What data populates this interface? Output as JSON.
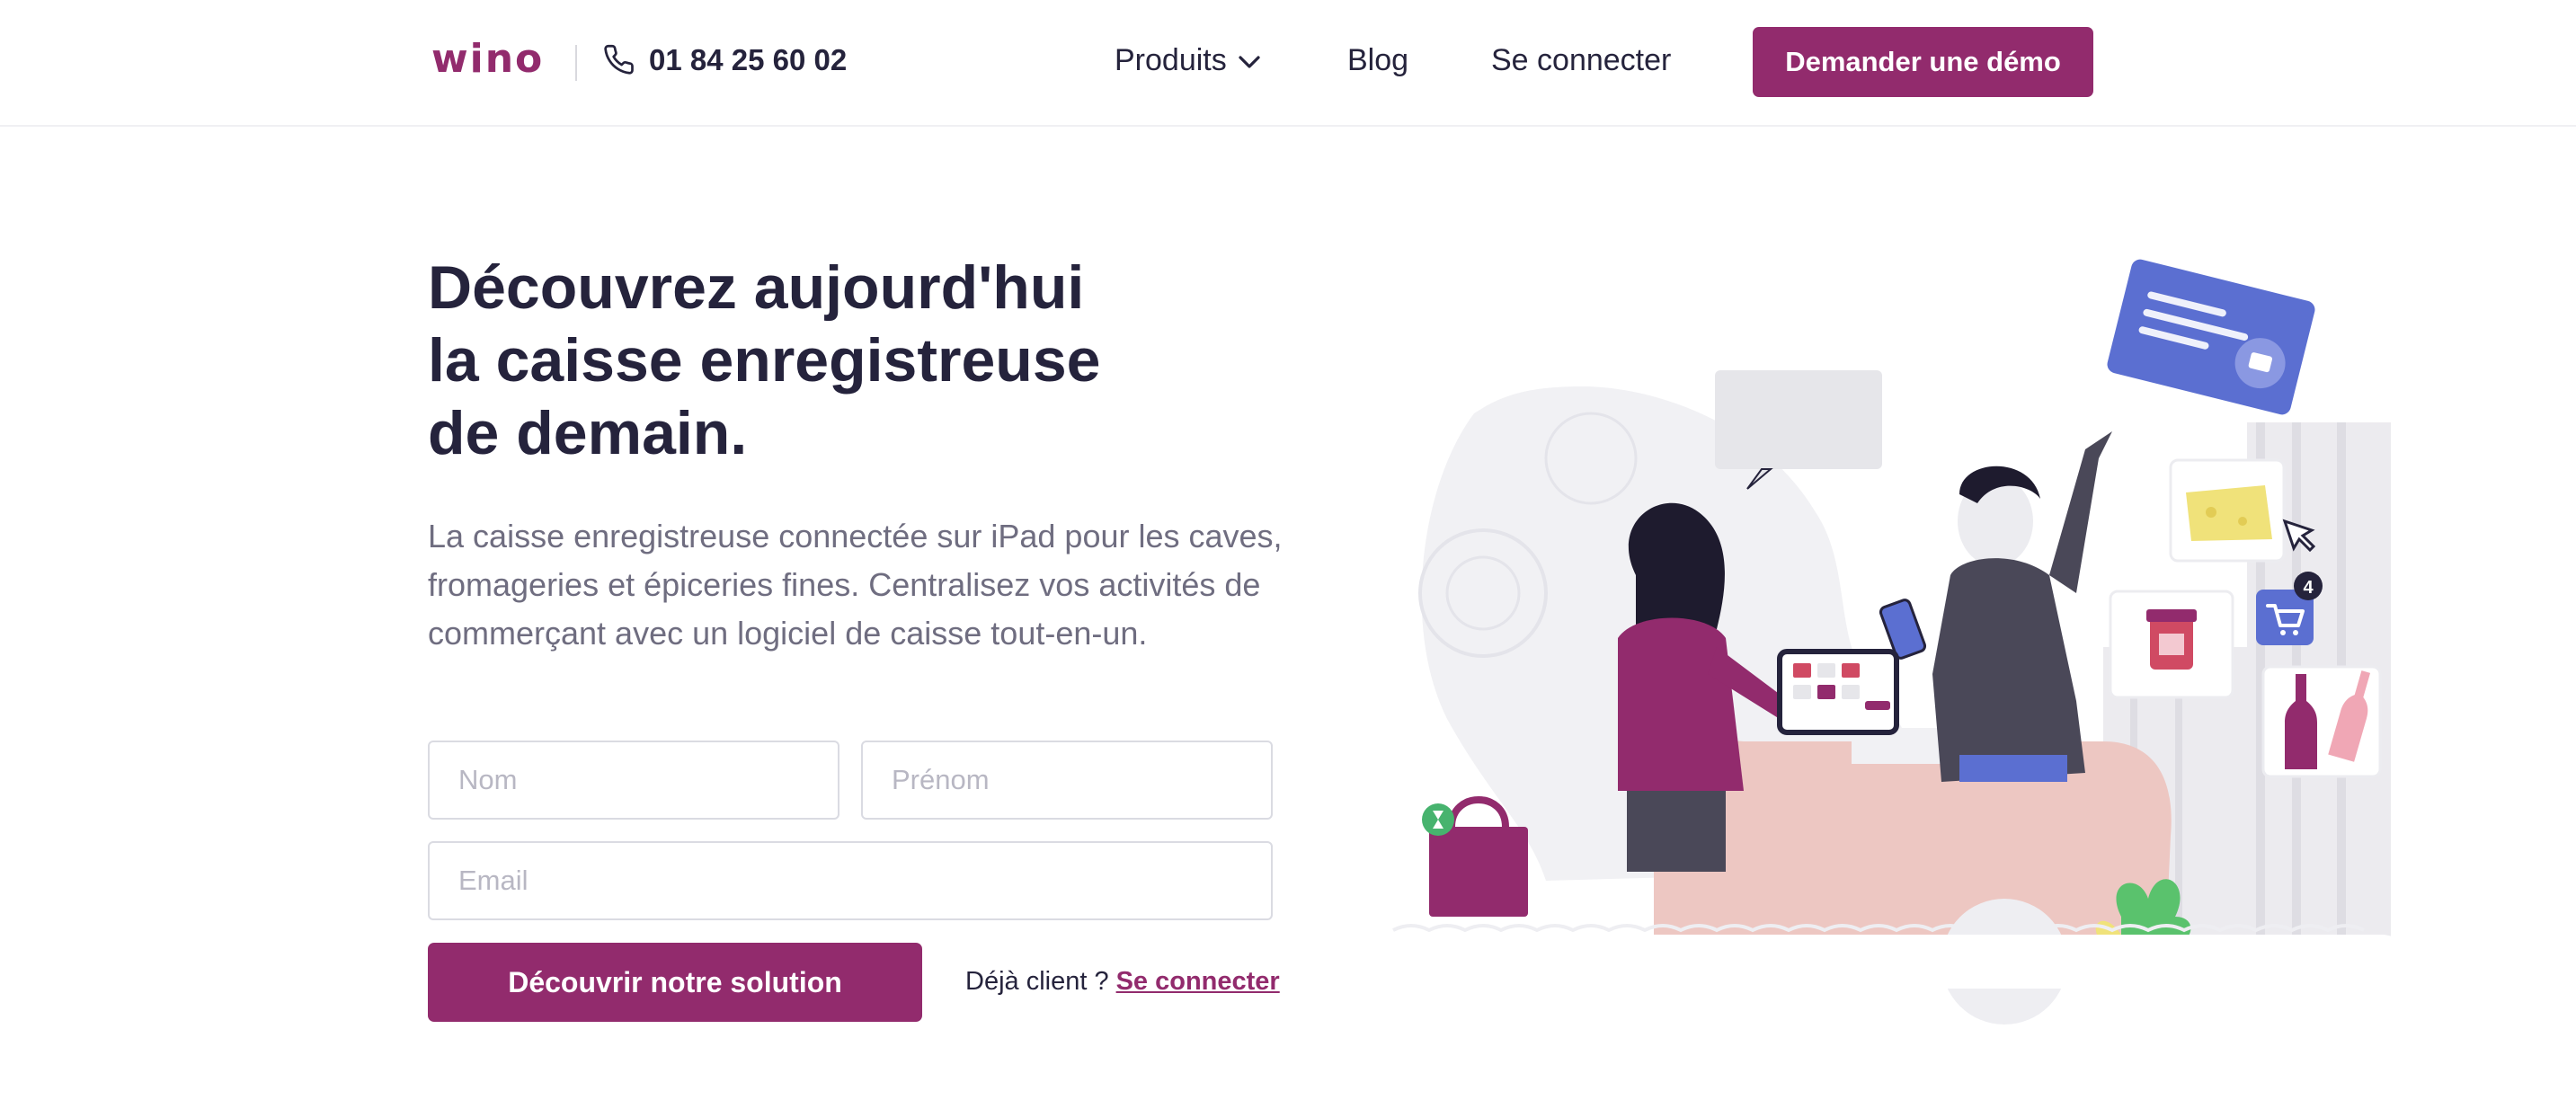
{
  "header": {
    "logo": "wino",
    "phone_icon": "phone-icon",
    "phone": "01 84 25 60 02",
    "nav": {
      "produits": "Produits",
      "produits_icon": "chevron-down-icon",
      "blog": "Blog",
      "login": "Se connecter"
    },
    "cta": "Demander une démo"
  },
  "hero": {
    "title_lines": [
      "Découvrez aujourd'hui",
      "la caisse enregistreuse",
      "de demain."
    ],
    "subtitle": "La caisse enregistreuse connectée sur iPad pour les caves, fromageries et épiceries fines. Centralisez vos activités de commerçant avec un logiciel de caisse tout-en-un.",
    "form": {
      "nom_placeholder": "Nom",
      "prenom_placeholder": "Prénom",
      "email_placeholder": "Email",
      "submit": "Découvrir notre solution"
    },
    "already_text": "Déjà client ?",
    "already_link": "Se connecter"
  },
  "illustration": {
    "cart_badge": "4"
  },
  "colors": {
    "brand": "#922b6d",
    "text": "#25233c",
    "muted": "#6f6d80",
    "accent_blue": "#5b6fd1"
  }
}
